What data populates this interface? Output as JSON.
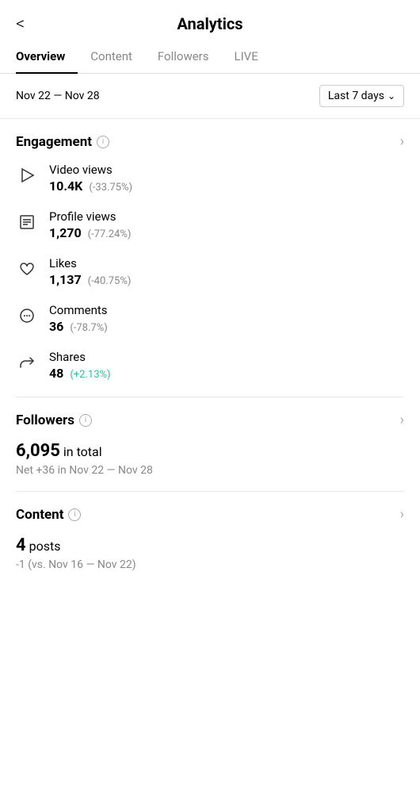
{
  "header": {
    "back_label": "<",
    "title": "Analytics"
  },
  "tabs": [
    {
      "id": "overview",
      "label": "Overview",
      "active": true
    },
    {
      "id": "content",
      "label": "Content",
      "active": false
    },
    {
      "id": "followers",
      "label": "Followers",
      "active": false
    },
    {
      "id": "live",
      "label": "LIVE",
      "active": false
    }
  ],
  "date_bar": {
    "range": "Nov 22 — Nov 28",
    "selector_label": "Last 7 days"
  },
  "engagement": {
    "section_title": "Engagement",
    "info_icon_label": "i",
    "metrics": [
      {
        "id": "video-views",
        "label": "Video views",
        "value": "10.4K",
        "change": "(-33.75%)",
        "positive": false
      },
      {
        "id": "profile-views",
        "label": "Profile views",
        "value": "1,270",
        "change": "(-77.24%)",
        "positive": false
      },
      {
        "id": "likes",
        "label": "Likes",
        "value": "1,137",
        "change": "(-40.75%)",
        "positive": false
      },
      {
        "id": "comments",
        "label": "Comments",
        "value": "36",
        "change": "(-78.7%)",
        "positive": false
      },
      {
        "id": "shares",
        "label": "Shares",
        "value": "48",
        "change": "(+2.13%)",
        "positive": true
      }
    ]
  },
  "followers": {
    "section_title": "Followers",
    "info_icon_label": "i",
    "total_count": "6,095",
    "in_total_label": "in total",
    "net_label": "Net +36 in Nov 22 — Nov 28"
  },
  "content": {
    "section_title": "Content",
    "info_icon_label": "i",
    "posts_count": "4",
    "posts_label": "posts",
    "compare_label": "-1 (vs. Nov 16 — Nov 22)"
  }
}
